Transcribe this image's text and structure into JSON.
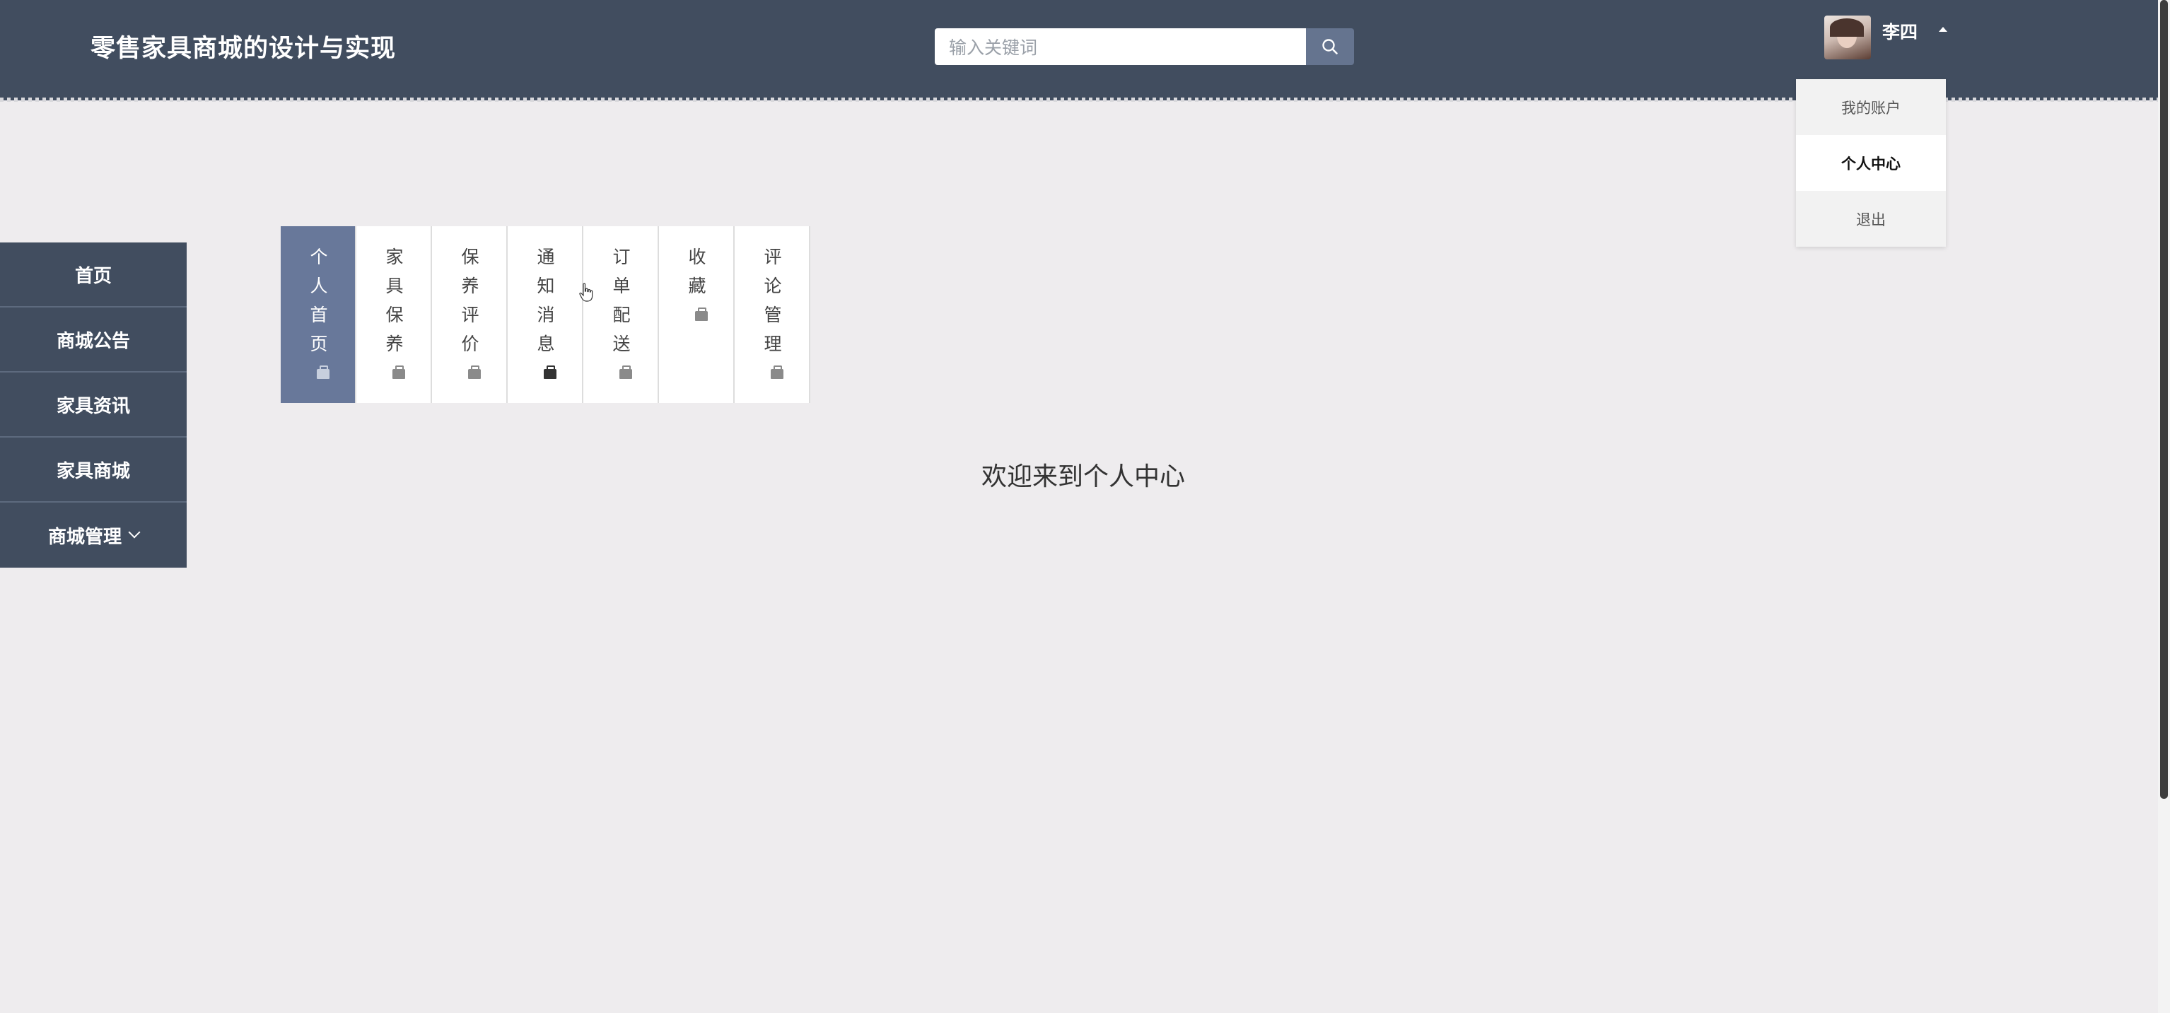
{
  "header": {
    "title": "零售家具商城的设计与实现",
    "search": {
      "placeholder": "输入关键词",
      "value": ""
    },
    "user": {
      "name": "李四"
    }
  },
  "user_menu": {
    "items": [
      {
        "label": "我的账户",
        "active": false
      },
      {
        "label": "个人中心",
        "active": true
      },
      {
        "label": "退出",
        "active": false
      }
    ]
  },
  "left_nav": {
    "items": [
      {
        "label": "首页"
      },
      {
        "label": "商城公告"
      },
      {
        "label": "家具资讯"
      },
      {
        "label": "家具商城"
      },
      {
        "label": "商城管理"
      }
    ]
  },
  "tabs": [
    {
      "label": "个人首页",
      "active": true
    },
    {
      "label": "家具保养",
      "active": false
    },
    {
      "label": "保养评价",
      "active": false
    },
    {
      "label": "通知消息",
      "active": false
    },
    {
      "label": "订单配送",
      "active": false
    },
    {
      "label": "收藏",
      "active": false
    },
    {
      "label": "评论管理",
      "active": false
    }
  ],
  "main": {
    "welcome": "欢迎来到个人中心"
  },
  "colors": {
    "header_bg": "#414d5f",
    "accent": "#68789a",
    "page_bg": "#eeecee"
  }
}
